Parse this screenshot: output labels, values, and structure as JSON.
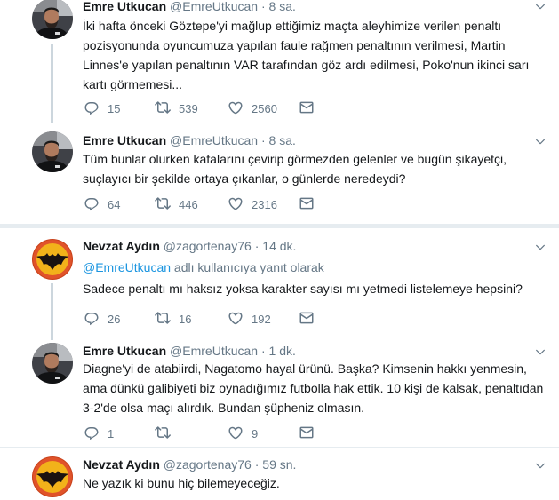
{
  "tweets": [
    {
      "name": "Emre Utkucan",
      "handle": "@EmreUtkucan",
      "dot": "·",
      "time": "8 sa.",
      "text": "İki hafta önceki Göztepe'yi mağlup ettiğimiz maçta aleyhimize verilen penaltı pozisyonunda oyuncumuza yapılan faule rağmen penaltının verilmesi, Martin Linnes'e yapılan penaltının VAR tarafından göz ardı edilmesi, Poko'nun ikinci sarı kartı görmemesi...",
      "replies": "15",
      "retweets": "539",
      "likes": "2560"
    },
    {
      "name": "Emre Utkucan",
      "handle": "@EmreUtkucan",
      "dot": "·",
      "time": "8 sa.",
      "text": "Tüm bunlar olurken kafalarını çevirip görmezden gelenler ve bugün şikayetçi, suçlayıcı bir şekilde ortaya çıkanlar, o günlerde neredeydi?",
      "replies": "64",
      "retweets": "446",
      "likes": "2316"
    },
    {
      "name": "Nevzat Aydın",
      "handle": "@zagortenay76",
      "dot": "·",
      "time": "14 dk.",
      "reply_mention": "@EmreUtkucan",
      "reply_suffix": " adlı kullanıcıya yanıt olarak",
      "text": "Sadece penaltı mı haksız yoksa karakter sayısı mı yetmedi listelemeye hepsini?",
      "replies": "26",
      "retweets": "16",
      "likes": "192"
    },
    {
      "name": "Emre Utkucan",
      "handle": "@EmreUtkucan",
      "dot": "·",
      "time": "1 dk.",
      "text": "Diagne'yi de atabiirdi, Nagatomo hayal ürünü. Başka? Kimsenin hakkı yenmesin, ama dünkü galibiyeti biz oynadığımız futbolla hak ettik. 10 kişi de kalsak, penaltıdan 3-2'de olsa maçı alırdık. Bundan şüpheniz olmasın.",
      "replies": "1",
      "retweets": "",
      "likes": "9"
    },
    {
      "name": "Nevzat Aydın",
      "handle": "@zagortenay76",
      "dot": "·",
      "time": "59 sn.",
      "text": "Ne yazık ki bunu hiç bilemeyeceğiz."
    }
  ]
}
